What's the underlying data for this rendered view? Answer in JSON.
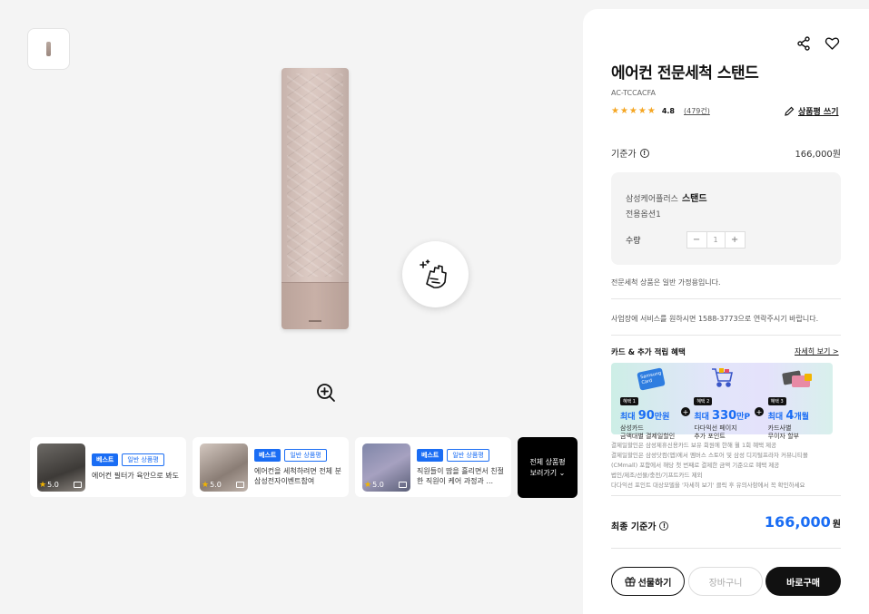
{
  "gallery": {
    "zoom_icon": "zoom-in-icon",
    "clean_badge_icon": "hand-wipe-sparkle-icon"
  },
  "reviews": [
    {
      "tag_best": "베스트",
      "tag_normal": "일반 상품평",
      "rating": "5.0",
      "text": "에어컨 필터가 육안으로 봐도"
    },
    {
      "tag_best": "베스트",
      "tag_normal": "일반 상품평",
      "rating": "5.0",
      "text": "에어컨을 세척하려면 전체 분 #삼성전자이벤트참여"
    },
    {
      "tag_best": "베스트",
      "tag_normal": "일반 상품평",
      "rating": "5.0",
      "text": "직원들이 땀을 흘리면서 친절 또한 직원이 케어 과정과 ..."
    }
  ],
  "all_reviews": {
    "line1": "전체 상품평",
    "line2": "보러가기"
  },
  "product": {
    "title": "에어컨 전문세척 스탠드",
    "model": "AC-TCCACFA",
    "stars": "★★★★★",
    "rating": "4.8",
    "review_count": "(479건)",
    "write_review": "상품평 쓰기",
    "base_price_label": "기준가",
    "base_price": "166,000원"
  },
  "option": {
    "name_prefix": "삼성케어플러스",
    "name_bold": "스탠드",
    "sub": "전용옵션1",
    "qty_label": "수량",
    "qty_minus": "−",
    "qty_value": "1",
    "qty_plus": "+"
  },
  "notices": {
    "home_only": "전문세척 상품은 일반 가정용입니다.",
    "business": "사업장에 서비스를 원하시면 1588-3773으로 연락주시기 바랍니다."
  },
  "benefits": {
    "title": "카드 & 추가 적립 혜택",
    "more": "자세히 보기 >",
    "items": [
      {
        "label": "혜택 1",
        "prefix": "최대 ",
        "amount": "90",
        "suffix": "만원",
        "desc1": "삼성카드",
        "desc2": "금액대별 결제일할인"
      },
      {
        "label": "혜택 2",
        "prefix": "최대 ",
        "amount": "330",
        "suffix": "만P",
        "desc1": "다다익선 페이지",
        "desc2": "추가 포인트"
      },
      {
        "label": "혜택 3",
        "prefix": "최대 ",
        "amount": "4",
        "suffix": "개월",
        "desc1": "카드사별",
        "desc2": "무이자 할부"
      }
    ],
    "card_text": "Samsung Card",
    "fine_print": [
      "결제일할인은 삼성제휴신용카드 보유 회원에 한해 월 1회 혜택 제공",
      "결제일할인은 삼성닷컴(앱)에서 멤버스 스토어 및 삼성 디지털프라자 커뮤니티몰",
      "(CMmall) 포함에서 해당 첫 번째로 결제한 금액 기준으로 혜택 제공",
      "법인/제조/선물/충전/기프트카드 제외",
      "다다익선 포인트 대상모델을 '자세히 보기' 클릭 후 유의사항에서 꼭 확인하세요"
    ]
  },
  "final": {
    "label": "최종 기준가",
    "price": "166,000",
    "unit": "원"
  },
  "buttons": {
    "gift": "선물하기",
    "cart": "장바구니",
    "buy": "바로구매"
  },
  "colors": {
    "accent": "#1a6df4",
    "star": "#f5a623"
  }
}
